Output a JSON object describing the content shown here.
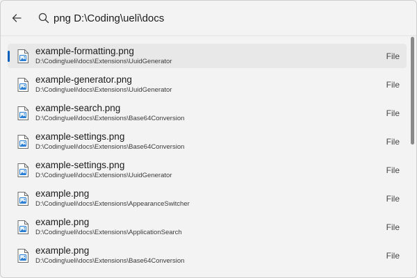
{
  "search": {
    "value": "png D:\\Coding\\ueli\\docs"
  },
  "results": [
    {
      "name": "example-formatting.png",
      "path": "D:\\Coding\\ueli\\docs\\Extensions\\UuidGenerator",
      "type": "File",
      "selected": true
    },
    {
      "name": "example-generator.png",
      "path": "D:\\Coding\\ueli\\docs\\Extensions\\UuidGenerator",
      "type": "File"
    },
    {
      "name": "example-search.png",
      "path": "D:\\Coding\\ueli\\docs\\Extensions\\Base64Conversion",
      "type": "File"
    },
    {
      "name": "example-settings.png",
      "path": "D:\\Coding\\ueli\\docs\\Extensions\\Base64Conversion",
      "type": "File"
    },
    {
      "name": "example-settings.png",
      "path": "D:\\Coding\\ueli\\docs\\Extensions\\UuidGenerator",
      "type": "File"
    },
    {
      "name": "example.png",
      "path": "D:\\Coding\\ueli\\docs\\Extensions\\AppearanceSwitcher",
      "type": "File"
    },
    {
      "name": "example.png",
      "path": "D:\\Coding\\ueli\\docs\\Extensions\\ApplicationSearch",
      "type": "File"
    },
    {
      "name": "example.png",
      "path": "D:\\Coding\\ueli\\docs\\Extensions\\Base64Conversion",
      "type": "File"
    }
  ],
  "colors": {
    "accent": "#005fb8",
    "background": "#f3f3f3",
    "selected_row": "#e8e8e8"
  },
  "icons": {
    "back": "arrow-left-icon",
    "search": "search-icon",
    "file": "image-file-icon"
  }
}
